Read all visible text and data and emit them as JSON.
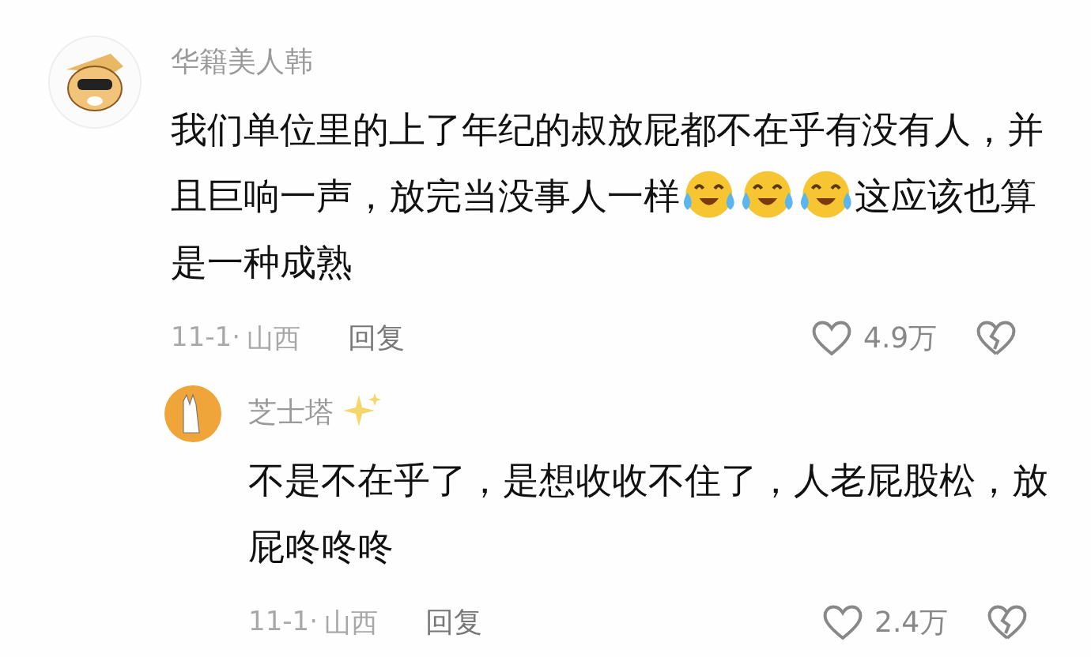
{
  "comments": [
    {
      "kind": "comment",
      "author": "华籍美人韩",
      "segments": [
        {
          "kind": "text",
          "text": "我们单位里的上了年纪的叔放屁都不在乎有没有人，并且巨响一声，放完当没事人一样"
        },
        {
          "kind": "emoji"
        },
        {
          "kind": "emoji"
        },
        {
          "kind": "emoji"
        },
        {
          "kind": "text",
          "text": "这应该也算是一种成熟"
        }
      ],
      "date": "11-1·",
      "location": "山西",
      "reply_label": "回复",
      "likes": "4.9万",
      "sparkle": false
    },
    {
      "kind": "reply",
      "author": "芝士塔",
      "segments": [
        {
          "kind": "text",
          "text": "不是不在乎了，是想收收不住了，人老屁股松，放屁咚咚咚"
        }
      ],
      "date": "11-1·",
      "location": "山西",
      "reply_label": "回复",
      "likes": "2.4万",
      "sparkle": true
    }
  ]
}
